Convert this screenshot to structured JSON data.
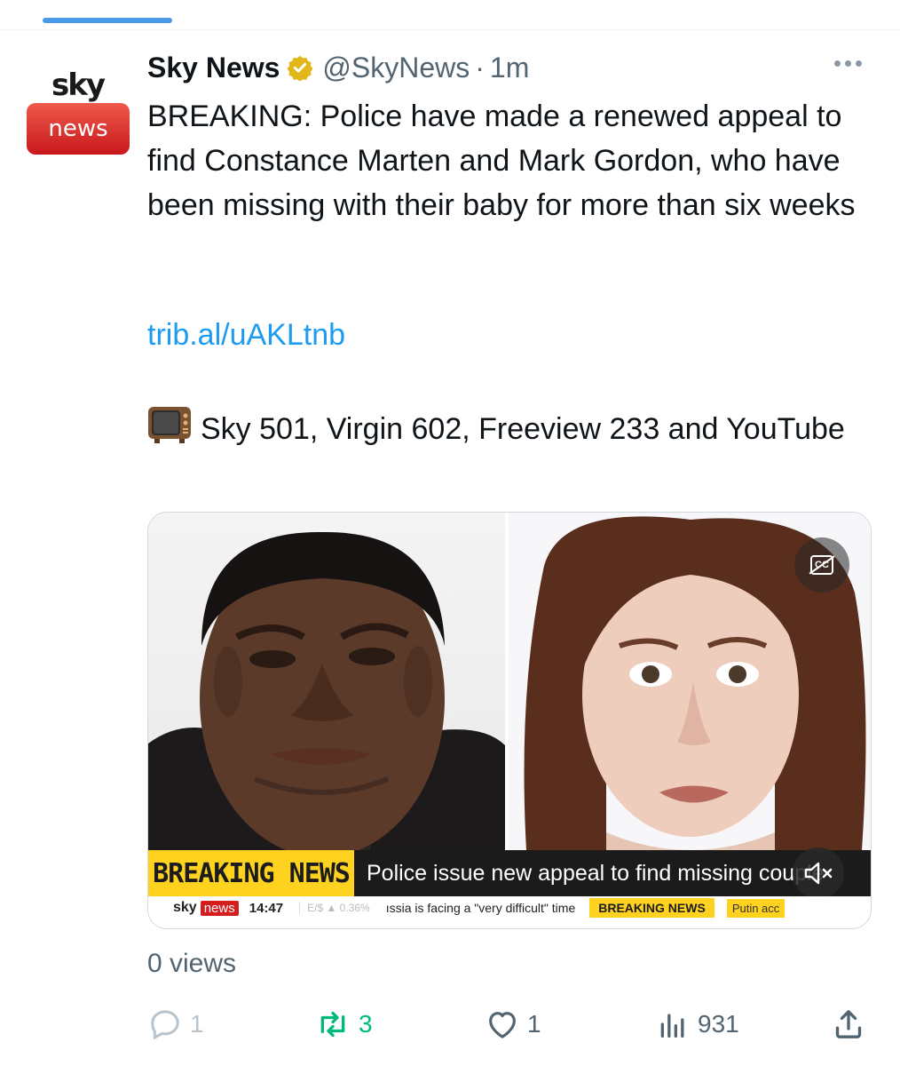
{
  "tweet": {
    "author_name": "Sky News",
    "handle": "@SkyNews",
    "separator": "·",
    "time": "1m",
    "avatar": {
      "top_word": "sky",
      "bottom_word": "news"
    },
    "text": "BREAKING: Police have made a renewed appeal to find Constance Marten and Mark Gordon, who have been missing with their baby for more than six weeks",
    "link": "trib.al/uAKLtnb",
    "tv_line": "Sky 501, Virgin 602, Freeview 233 and YouTube",
    "tv_icon": "television-emoji"
  },
  "media": {
    "breaking_label": "BREAKING NEWS",
    "headline": "Police issue new appeal to find missing couple",
    "ticker": {
      "logo_sky": "sky",
      "logo_news": "news",
      "clock": "14:47",
      "fx": "E/$ ▲ 0.36%",
      "story": "ıssia is facing a \"very difficult\" time",
      "tag": "BREAKING NEWS",
      "story2": "Putin acc"
    },
    "icons": {
      "captions": "captions-off-icon",
      "mute": "muted-speaker-icon"
    }
  },
  "footer": {
    "views_label": "0 views",
    "reply_count": "1",
    "retweet_count": "3",
    "like_count": "1",
    "view_count": "931"
  },
  "colors": {
    "link": "#1d9bf0",
    "retweet": "#00ba7c",
    "verified": "#e2b719",
    "breaking_yellow": "#ffd21f",
    "sky_red": "#c8171b"
  }
}
